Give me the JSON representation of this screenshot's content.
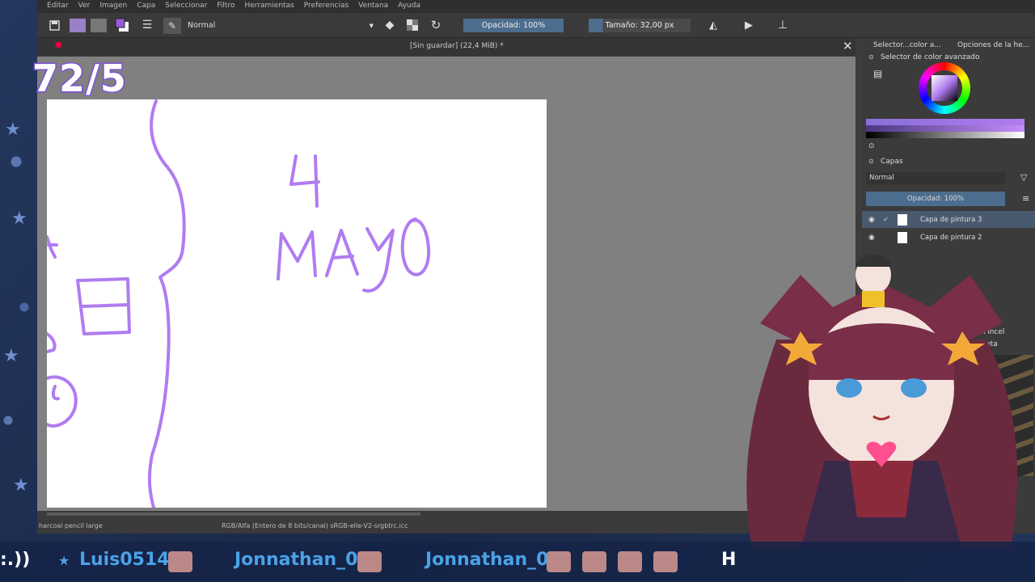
{
  "overlay": {
    "counter": "72/5"
  },
  "menu": [
    "Editar",
    "Ver",
    "Imagen",
    "Capa",
    "Seleccionar",
    "Filtro",
    "Herramientas",
    "Preferencias",
    "Ventana",
    "Ayuda"
  ],
  "toolbar": {
    "blend_mode": "Normal",
    "opacity": "Opacidad: 100%",
    "size": "Tamaño: 32,00 px"
  },
  "document": {
    "title": "[Sin guardar]  (22,4 MiB) *"
  },
  "canvas": {
    "drawn_text": [
      "4",
      "MAYO"
    ]
  },
  "status": {
    "brush": "harcoal pencil large",
    "color_profile": "RGB/Alfa (Entero de 8 bits/canal)  sRGB-elle-V2-srgbtrc.icc"
  },
  "dock": {
    "tabs": [
      "Selector...color a...",
      "Opciones de la he..."
    ],
    "color_panel_title": "Selector de color avanzado",
    "layers_title": "Capas",
    "layers_blend": "Normal",
    "layers_opacity": "Opacidad:  100%",
    "layers": [
      {
        "name": "Capa de pintura 3",
        "selected": true
      },
      {
        "name": "Capa de pintura 2",
        "selected": false
      }
    ],
    "brush_panel_title": "Pincel",
    "brush_tag": "Etiqueta"
  },
  "ticker": {
    "names": [
      "Luis0514",
      "Jonnathan_0",
      "Jonnathan_0",
      "H"
    ],
    "left_fragment": ":.))"
  },
  "colors": {
    "accent_purple": "#b07cf0",
    "ticker_blue": "#4aa2e8",
    "selection_blue": "#4d6d8e"
  }
}
